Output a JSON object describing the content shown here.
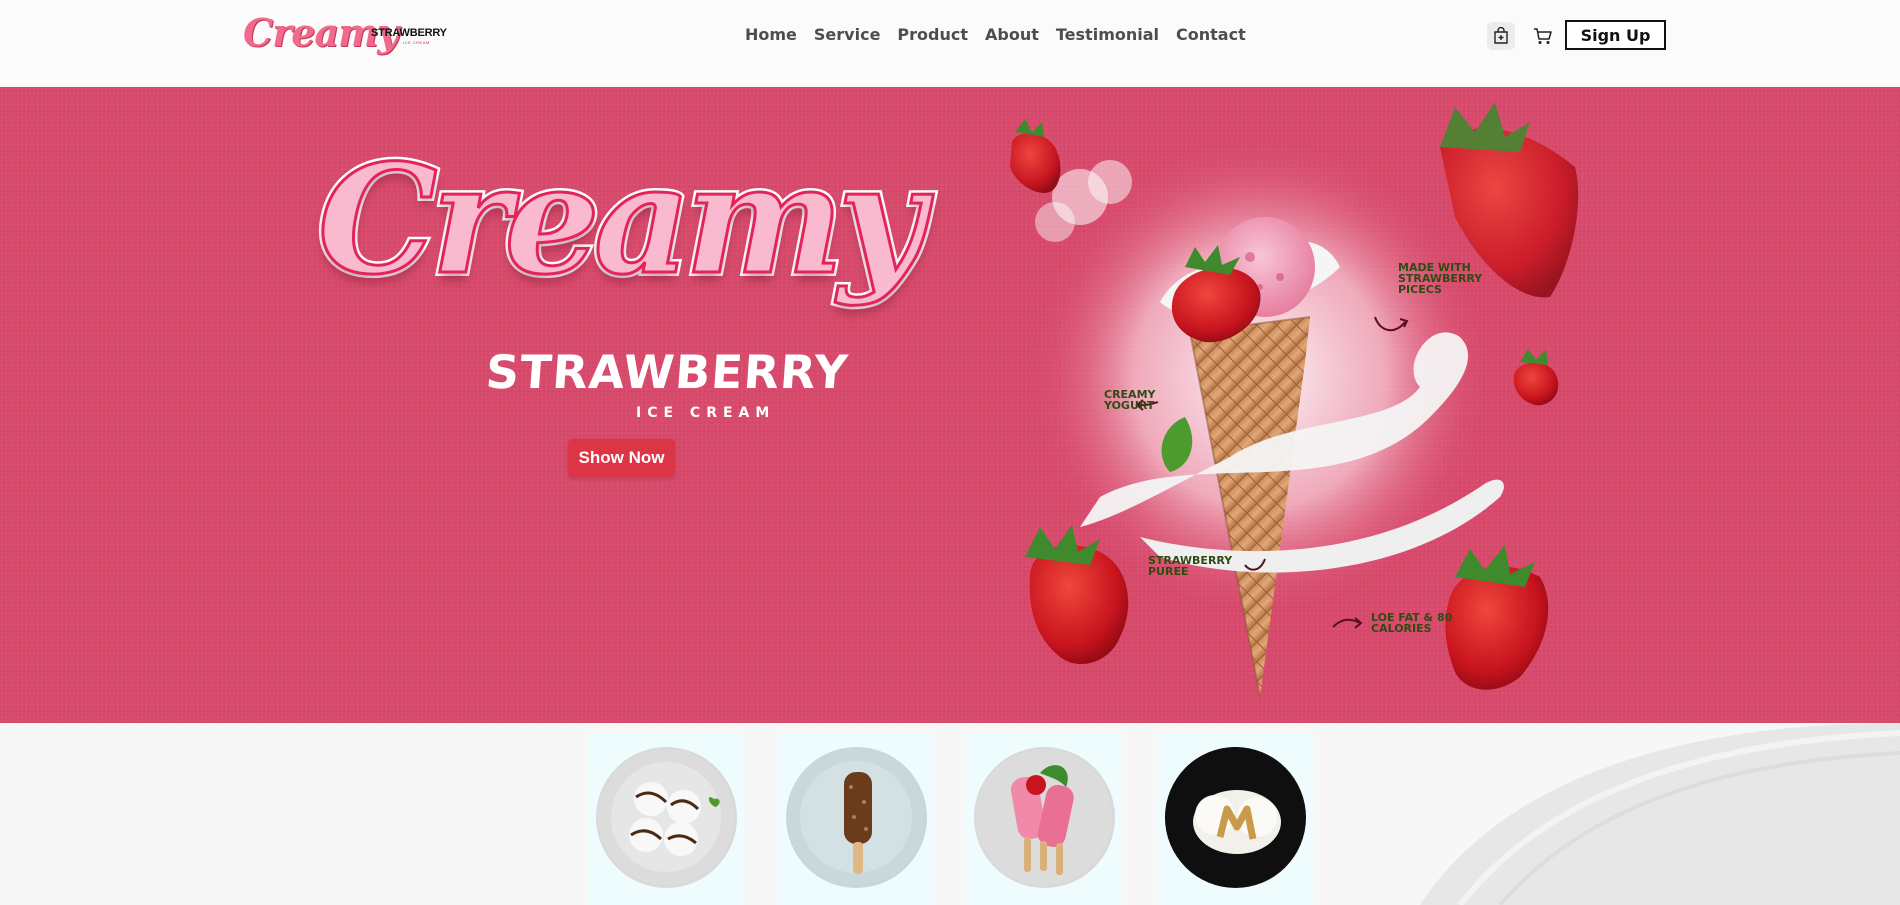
{
  "brand": {
    "logo_script": "Creamy",
    "logo_word": "STRAWBERRY",
    "logo_sub": "ICE CREAM"
  },
  "nav": {
    "links": [
      "Home",
      "Service",
      "Product",
      "About",
      "Testimonial",
      "Contact"
    ],
    "signup_label": "Sign Up"
  },
  "icons": {
    "bag": "shopping-bag-icon",
    "cart": "cart-icon"
  },
  "hero": {
    "title_script": "Creamy",
    "title_main": "STRAWBERRY",
    "title_sub": "ICE CREAM",
    "cta_label": "Show Now",
    "annotations": {
      "made_with": "MADE WITH STRAWBERRY PICECS",
      "creamy_yogurt": "CREAMY YOGURT",
      "strawberry_puree": "STRAWBERRY PUREE",
      "low_fat": "LOE FAT & 80 CALORIES"
    }
  },
  "colors": {
    "hero_bg": "#d84a6c",
    "cta": "#dc3545",
    "logo_pink": "#f06a8c",
    "card_bg": "#eefcfd"
  },
  "products": [
    {
      "name": "scoops-plate"
    },
    {
      "name": "choco-bar"
    },
    {
      "name": "strawberry-popsicles"
    },
    {
      "name": "caramel-scoop"
    }
  ]
}
